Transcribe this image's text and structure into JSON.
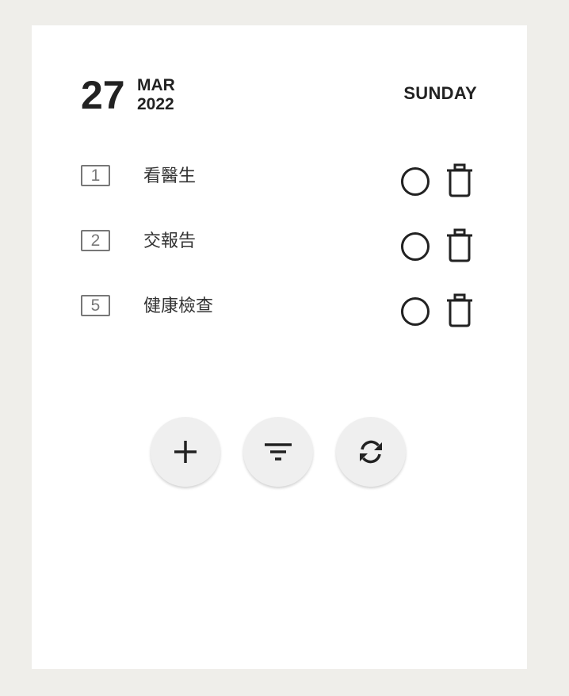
{
  "header": {
    "day": "27",
    "month": "MAR",
    "year": "2022",
    "weekday": "SUNDAY"
  },
  "tasks": [
    {
      "priority": "1",
      "title": "看醫生"
    },
    {
      "priority": "2",
      "title": "交報告"
    },
    {
      "priority": "5",
      "title": "健康檢查"
    }
  ],
  "icons": {
    "complete": "circle-icon",
    "delete": "trash-icon",
    "add": "plus-icon",
    "filter": "filter-icon",
    "refresh": "sync-icon"
  },
  "colors": {
    "background": "#efeeea",
    "card": "#ffffff",
    "text": "#222222",
    "fab": "#efefef"
  }
}
